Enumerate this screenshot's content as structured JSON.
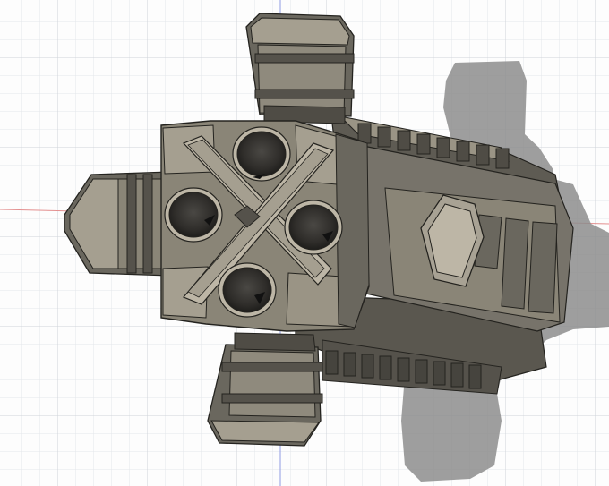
{
  "viewport": {
    "background": "#fdfdfd",
    "grid_minor_color": "#e4e6ea",
    "grid_major_color": "#cfd3d9",
    "axis_x_color": "#e38f8f",
    "axis_y_color": "#8f9be3"
  },
  "model": {
    "body_dark": "#55524b",
    "body_mid": "#6c6a62",
    "body_light": "#8f8a7d",
    "face_light": "#a59f90",
    "face_highlight": "#bdb6a6",
    "edge": "#24231f",
    "hole": "#2a2926",
    "shadow": "#8d8d8d"
  }
}
